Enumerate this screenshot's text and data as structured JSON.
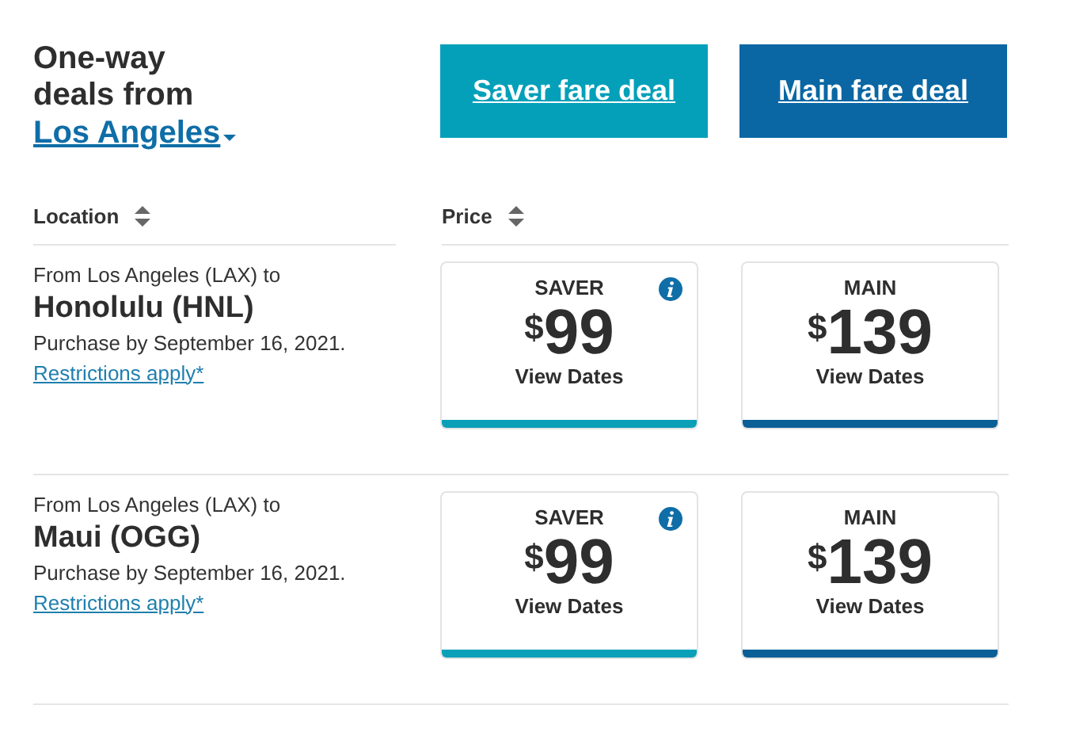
{
  "heading": {
    "line": "One-way deals from",
    "city": "Los Angeles"
  },
  "deal_buttons": [
    {
      "label": "Saver fare deal",
      "kind": "saver"
    },
    {
      "label": "Main fare deal",
      "kind": "main"
    }
  ],
  "columns": [
    "Location",
    "Price"
  ],
  "rows": [
    {
      "from": "From Los Angeles (LAX) to",
      "destination": "Honolulu (HNL)",
      "purchase_by": "Purchase by September 16, 2021.",
      "restrictions": "Restrictions apply*",
      "fares": [
        {
          "kind": "saver",
          "label": "SAVER",
          "info": true,
          "currency": "$",
          "amount": "99",
          "action": "View Dates"
        },
        {
          "kind": "main",
          "label": "MAIN",
          "info": false,
          "currency": "$",
          "amount": "139",
          "action": "View Dates"
        }
      ]
    },
    {
      "from": "From Los Angeles (LAX) to",
      "destination": "Maui (OGG)",
      "purchase_by": "Purchase by September 16, 2021.",
      "restrictions": "Restrictions apply*",
      "fares": [
        {
          "kind": "saver",
          "label": "SAVER",
          "info": true,
          "currency": "$",
          "amount": "99",
          "action": "View Dates"
        },
        {
          "kind": "main",
          "label": "MAIN",
          "info": false,
          "currency": "$",
          "amount": "139",
          "action": "View Dates"
        }
      ]
    }
  ]
}
